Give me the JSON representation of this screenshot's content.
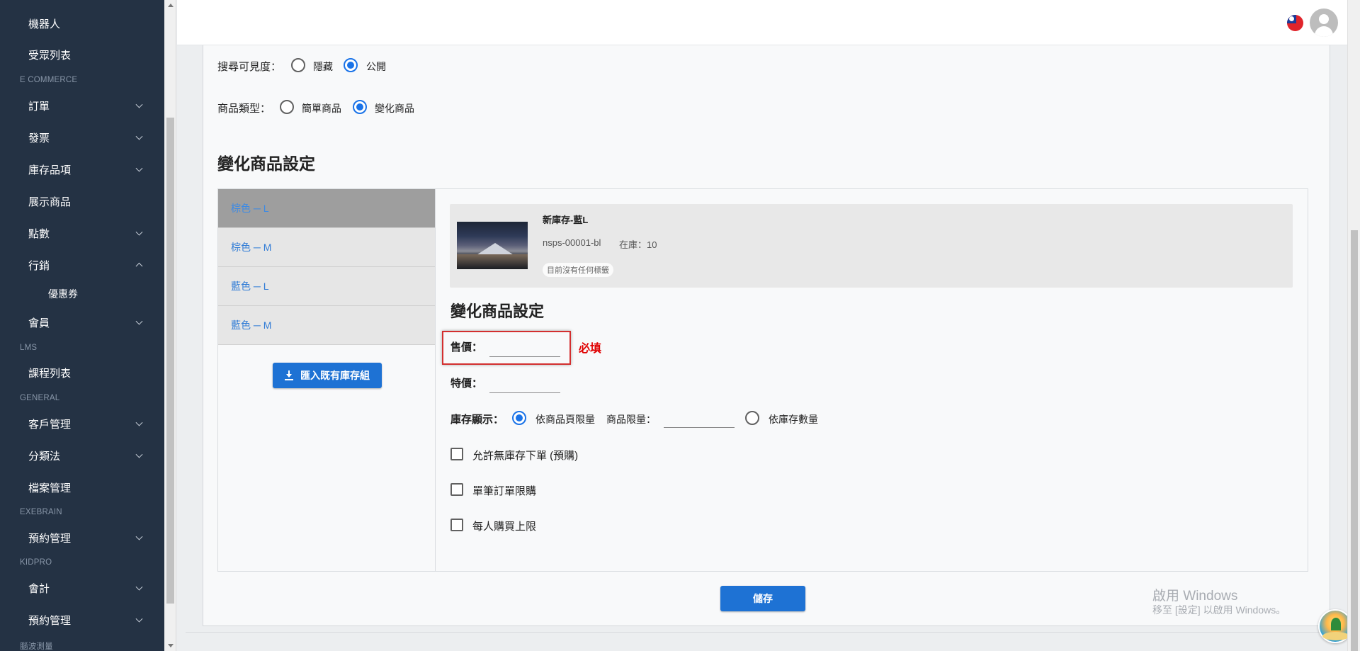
{
  "sidebar": {
    "items": [
      {
        "label": "機器人",
        "chevron": "none"
      },
      {
        "label": "受眾列表",
        "chevron": "none"
      },
      {
        "label": "訂單",
        "chevron": "down"
      },
      {
        "label": "發票",
        "chevron": "down"
      },
      {
        "label": "庫存品項",
        "chevron": "down"
      },
      {
        "label": "展示商品",
        "chevron": "none"
      },
      {
        "label": "點數",
        "chevron": "down"
      },
      {
        "label": "行銷",
        "chevron": "up"
      },
      {
        "label": "優惠券",
        "chevron": "none"
      },
      {
        "label": "會員",
        "chevron": "down"
      },
      {
        "label": "課程列表",
        "chevron": "none"
      },
      {
        "label": "客戶管理",
        "chevron": "down"
      },
      {
        "label": "分類法",
        "chevron": "down"
      },
      {
        "label": "檔案管理",
        "chevron": "none"
      },
      {
        "label": "預約管理",
        "chevron": "down"
      },
      {
        "label": "會計",
        "chevron": "down"
      },
      {
        "label": "預約管理",
        "chevron": "down"
      }
    ],
    "sections": [
      "E COMMERCE",
      "LMS",
      "GENERAL",
      "EXEBRAIN",
      "KIDPRO",
      "腦波測量"
    ]
  },
  "header": {
    "language_flag": "taiwan-flag-icon",
    "avatar": "user-avatar-icon"
  },
  "form": {
    "visibility": {
      "label": "搜尋可見度：",
      "options": [
        "隱藏",
        "公開"
      ],
      "selected": "公開"
    },
    "product_type": {
      "label": "商品類型：",
      "options": [
        "簡單商品",
        "變化商品"
      ],
      "selected": "變化商品"
    },
    "section_title": "變化商品設定"
  },
  "variants": {
    "items": [
      "棕色 ─ L",
      "棕色 ─ M",
      "藍色 ─ L",
      "藍色 ─ M"
    ],
    "active_index": 0,
    "import_button": "匯入既有庫存組"
  },
  "product": {
    "name": "新庫存-藍L",
    "sku": "nsps-00001-bl",
    "stock": "在庫：10",
    "tag": "目前沒有任何標籤"
  },
  "variant_settings": {
    "title": "變化商品設定",
    "price_label": "售價：",
    "price_value": "",
    "required_note": "必填",
    "special_price_label": "特價：",
    "special_price_value": "",
    "stock_display_label": "庫存顯示：",
    "stock_display_options": [
      "依商品頁限量",
      "依庫存數量"
    ],
    "stock_display_selected": "依商品頁限量",
    "limit_label": "商品限量：",
    "limit_value": "",
    "checkboxes": [
      {
        "label": "允許無庫存下單 (預購)",
        "checked": false
      },
      {
        "label": "單筆訂單限購",
        "checked": false
      },
      {
        "label": "每人購買上限",
        "checked": false
      }
    ]
  },
  "save_button": "儲存",
  "watermark": {
    "line1": "啟用 Windows",
    "line2": "移至 [設定] 以啟用 Windows。"
  },
  "colors": {
    "sidebar_bg": "#243244",
    "accent": "#1e72d4",
    "required": "#e00000",
    "highlight_box": "#d32f2f"
  }
}
